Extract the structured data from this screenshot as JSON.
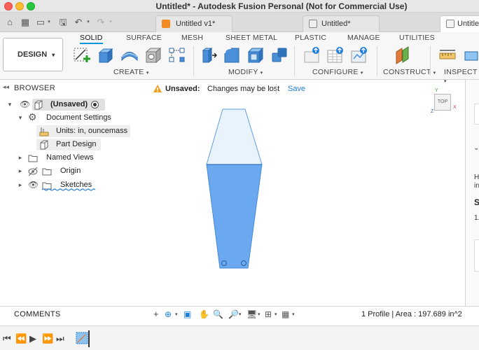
{
  "window": {
    "title": "Untitled* - Autodesk Fusion Personal (Not for Commercial Use)"
  },
  "tabs": [
    {
      "label": "Untitled v1*"
    },
    {
      "label": "Untitled*"
    },
    {
      "label": "Untitle"
    }
  ],
  "ribbon": {
    "workspace": "DESIGN",
    "tabs": [
      "SOLID",
      "SURFACE",
      "MESH",
      "SHEET METAL",
      "PLASTIC",
      "MANAGE",
      "UTILITIES"
    ],
    "groups": [
      "CREATE",
      "MODIFY",
      "CONFIGURE",
      "CONSTRUCT",
      "INSPECT"
    ]
  },
  "browser": {
    "title": "BROWSER",
    "root": "(Unsaved)",
    "items": [
      {
        "label": "Document Settings"
      },
      {
        "label": "Units: in, ouncemass"
      },
      {
        "label": "Part Design"
      },
      {
        "label": "Named Views"
      },
      {
        "label": "Origin"
      },
      {
        "label": "Sketches"
      }
    ]
  },
  "banner": {
    "label": "Unsaved:",
    "message": "Changes may be lost",
    "action": "Save"
  },
  "viewcube": {
    "face": "TOP",
    "axis_x": "X",
    "axis_y": "Y",
    "axis_z": "Z"
  },
  "status": {
    "comments": "COMMENTS",
    "profile": "1 Profile | Area : 197.689 in^2"
  },
  "right_panel": {
    "letters": [
      "H",
      "in",
      "S",
      "1."
    ]
  },
  "colors": {
    "accent": "#0696d7",
    "profile_fill": "#6aa9ef",
    "upper_fill": "#e9f3fc",
    "warning": "#f0a020"
  }
}
